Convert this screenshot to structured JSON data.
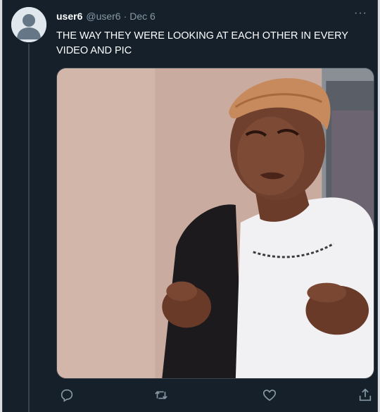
{
  "tweet": {
    "username": "user6",
    "handle": "@user6",
    "separator": "·",
    "date": "Dec 6",
    "text": "THE WAY THEY WERE LOOKING AT EACH OTHER IN EVERY VIDEO AND PIC",
    "more_label": "···"
  },
  "icons": {
    "more": "more-horizontal-icon",
    "reply": "reply-icon",
    "retweet": "retweet-icon",
    "like": "heart-icon",
    "share": "share-icon",
    "avatar": "default-avatar-icon"
  },
  "media": {
    "description_icon": "image-photo"
  },
  "colors": {
    "background": "#15202b",
    "text_primary": "#ffffff",
    "text_secondary": "#8899a6",
    "thread_line": "#38444d"
  }
}
